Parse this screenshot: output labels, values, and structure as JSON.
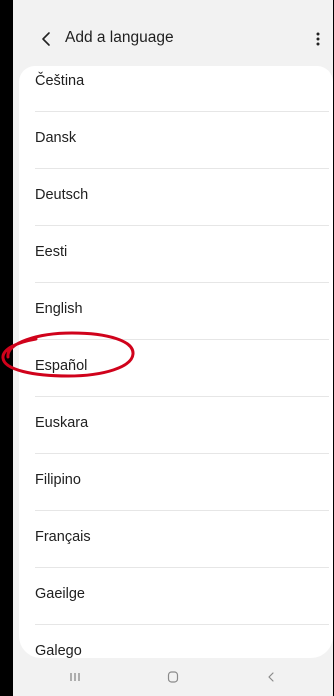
{
  "header": {
    "title": "Add a language",
    "back_icon": "chevron-left-icon",
    "more_icon": "more-vertical-icon"
  },
  "languages": [
    {
      "label": "Čeština"
    },
    {
      "label": "Dansk"
    },
    {
      "label": "Deutsch"
    },
    {
      "label": "Eesti"
    },
    {
      "label": "English"
    },
    {
      "label": "Español"
    },
    {
      "label": "Euskara"
    },
    {
      "label": "Filipino"
    },
    {
      "label": "Français"
    },
    {
      "label": "Gaeilge"
    },
    {
      "label": "Galego"
    }
  ],
  "annotation": {
    "highlighted_item": "Español",
    "color": "#d0021b"
  },
  "navbar": {
    "recent_icon": "recent-apps-icon",
    "home_icon": "home-icon",
    "back_icon": "back-icon"
  },
  "colors": {
    "background": "#f2f2f2",
    "card": "#ffffff",
    "text": "#202020",
    "divider": "#e6e6e6"
  }
}
